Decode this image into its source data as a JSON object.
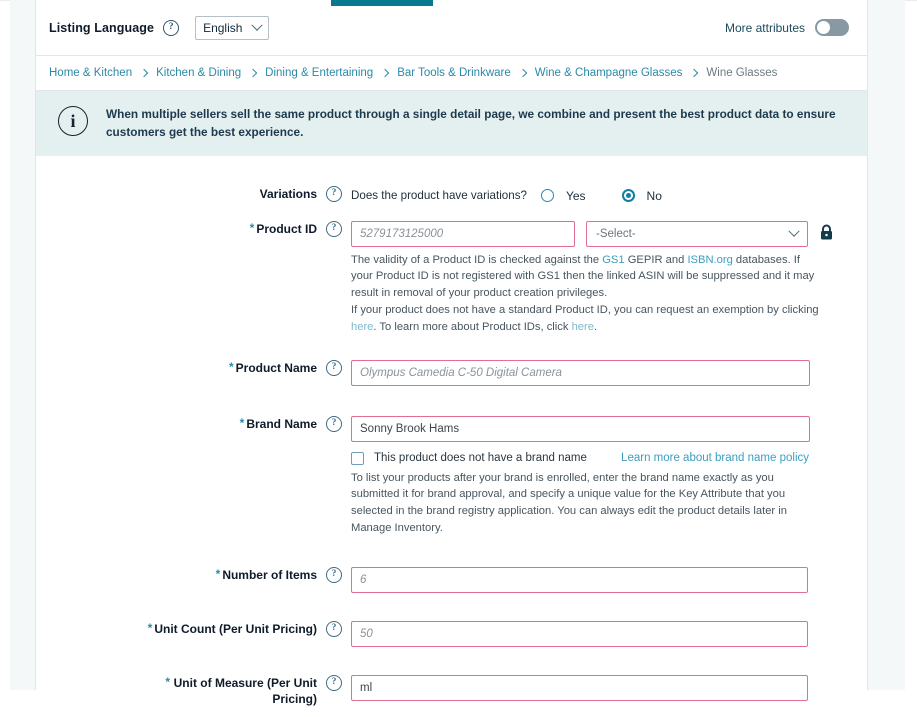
{
  "header": {
    "listing_language_label": "Listing Language",
    "help_icon": "question-circle-icon",
    "language_value": "English",
    "more_attributes_label": "More attributes",
    "more_attributes_state": "off"
  },
  "breadcrumb": {
    "items": [
      {
        "label": "Home & Kitchen",
        "current": false
      },
      {
        "label": "Kitchen & Dining",
        "current": false
      },
      {
        "label": "Dining & Entertaining",
        "current": false
      },
      {
        "label": "Bar Tools & Drinkware",
        "current": false
      },
      {
        "label": "Wine & Champagne Glasses",
        "current": false
      },
      {
        "label": "Wine Glasses",
        "current": true
      }
    ]
  },
  "banner": {
    "icon": "info-circle-icon",
    "text": "When multiple sellers sell the same product through a single detail page, we combine and present the best product data to ensure customers get the best experience."
  },
  "form": {
    "variations": {
      "label": "Variations",
      "question": "Does the product have variations?",
      "options": [
        {
          "label": "Yes",
          "selected": false
        },
        {
          "label": "No",
          "selected": true
        }
      ]
    },
    "product_id": {
      "label": "Product ID",
      "required": "*",
      "placeholder": "5279173125000",
      "select_value": "-Select-",
      "lock_icon": "lock-icon",
      "help_line1_a": "The validity of a Product ID is checked against the ",
      "help_link_gs1": "GS1",
      "help_line1_b": " GEPIR and ",
      "help_link_isbn": "ISBN.org",
      "help_line1_c": " databases. If your Product ID is not registered with GS1 then the linked ASIN will be suppressed and it may result in removal of your product creation privileges.",
      "help_line2_a": "If your product does not have a standard Product ID, you can request an exemption by clicking ",
      "help_link_here1": "here",
      "help_line2_b": ". To learn more about Product IDs, click ",
      "help_link_here2": "here",
      "help_line2_c": "."
    },
    "product_name": {
      "label": "Product Name",
      "required": "*",
      "placeholder": "Olympus Camedia C-50 Digital Camera"
    },
    "brand_name": {
      "label": "Brand Name",
      "required": "*",
      "value": "Sonny Brook Hams",
      "checkbox_label": "This product does not have a brand name",
      "checkbox_checked": false,
      "policy_link": "Learn more about brand name policy",
      "help_text": "To list your products after your brand is enrolled, enter the brand name exactly as you submitted it for brand approval, and specify a unique value for the Key Attribute that you selected in the brand registry application. You can always edit the product details later in Manage Inventory."
    },
    "number_of_items": {
      "label": "Number of Items",
      "required": "*",
      "placeholder": "6"
    },
    "unit_count": {
      "label": "Unit Count (Per Unit Pricing)",
      "required": "*",
      "placeholder": "50"
    },
    "unit_of_measure": {
      "label": "Unit of Measure (Per Unit Pricing)",
      "required": "*",
      "value": "ml"
    }
  },
  "colors": {
    "accent_teal": "#067a8c",
    "link_blue": "#2b8aa8",
    "error_border": "#e0708f",
    "banner_bg": "#e4eff0"
  }
}
